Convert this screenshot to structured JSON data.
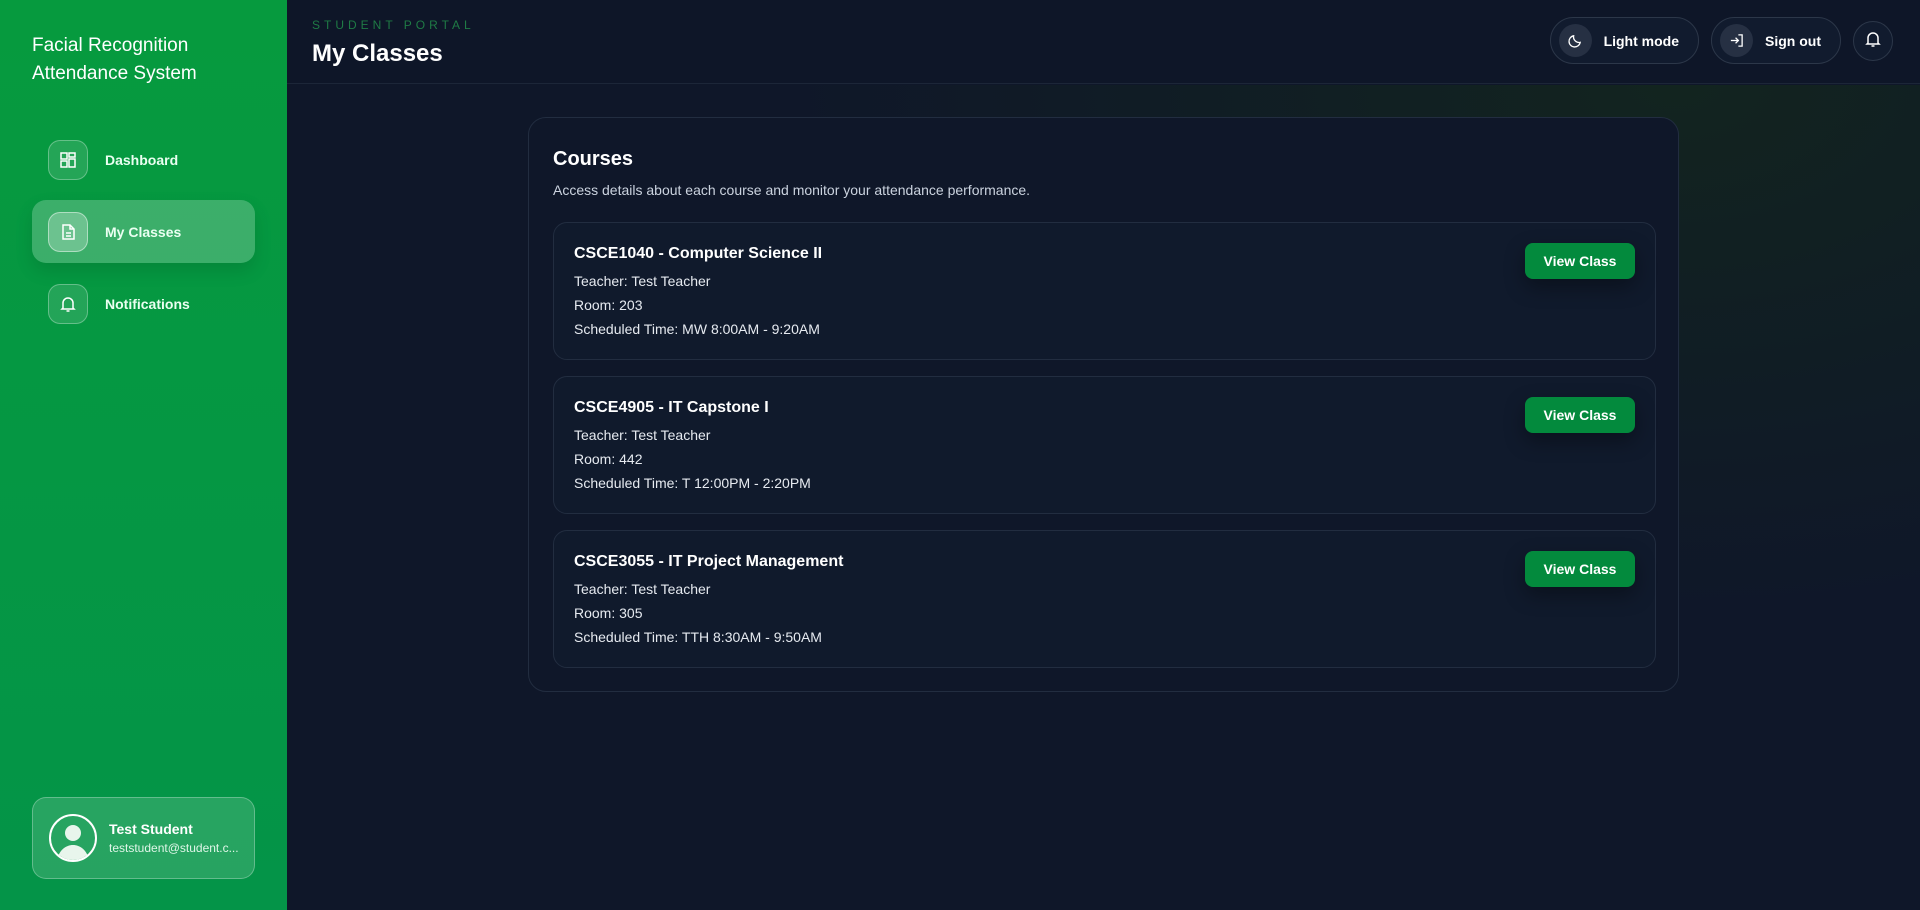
{
  "sidebar": {
    "app_title": "Facial Recognition Attendance System",
    "items": [
      {
        "label": "Dashboard",
        "icon": "dashboard-icon"
      },
      {
        "label": "My Classes",
        "icon": "document-icon",
        "active": true
      },
      {
        "label": "Notifications",
        "icon": "bell-icon"
      }
    ],
    "user": {
      "name": "Test Student",
      "email": "teststudent@student.c..."
    }
  },
  "header": {
    "portal_label": "STUDENT PORTAL",
    "page_title": "My Classes",
    "light_mode_label": "Light mode",
    "sign_out_label": "Sign out"
  },
  "courses": {
    "title": "Courses",
    "subtitle": "Access details about each course and monitor your attendance performance.",
    "items": [
      {
        "name": "CSCE1040 - Computer Science II",
        "teacher": "Teacher: Test Teacher",
        "room": "Room: 203",
        "time": "Scheduled Time: MW 8:00AM - 9:20AM",
        "button": "View Class"
      },
      {
        "name": "CSCE4905 - IT Capstone I",
        "teacher": "Teacher: Test Teacher",
        "room": "Room: 442",
        "time": "Scheduled Time: T 12:00PM - 2:20PM",
        "button": "View Class"
      },
      {
        "name": "CSCE3055 - IT Project Management",
        "teacher": "Teacher: Test Teacher",
        "room": "Room: 305",
        "time": "Scheduled Time: TTH 8:30AM - 9:50AM",
        "button": "View Class"
      }
    ]
  },
  "colors": {
    "sidebar_green": "#069a3e",
    "button_green": "#038a3d",
    "background": "#0f1729"
  }
}
